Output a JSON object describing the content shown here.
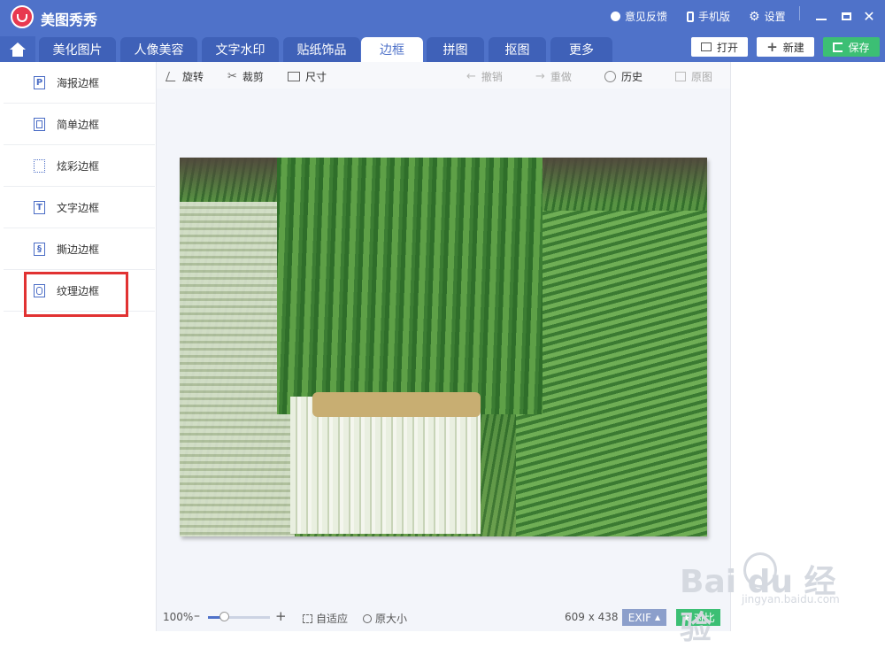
{
  "app": {
    "title": "美图秀秀"
  },
  "titlebar": {
    "feedback": "意见反馈",
    "mobile": "手机版",
    "settings": "设置",
    "icons": [
      "feedback-icon",
      "phone-icon",
      "gear-icon",
      "minimize-icon",
      "maximize-icon",
      "close-icon"
    ]
  },
  "tabs": [
    {
      "label": "美化图片",
      "active": false
    },
    {
      "label": "人像美容",
      "active": false
    },
    {
      "label": "文字水印",
      "active": false
    },
    {
      "label": "贴纸饰品",
      "active": false
    },
    {
      "label": "边框",
      "active": true
    },
    {
      "label": "拼图",
      "active": false
    },
    {
      "label": "抠图",
      "active": false
    },
    {
      "label": "更多",
      "active": false
    }
  ],
  "actions": {
    "open": "打开",
    "new": "新建",
    "save": "保存"
  },
  "sidebar": {
    "items": [
      {
        "label": "海报边框",
        "icon": "poster-frame-icon"
      },
      {
        "label": "简单边框",
        "icon": "simple-frame-icon"
      },
      {
        "label": "炫彩边框",
        "icon": "colorful-frame-icon"
      },
      {
        "label": "文字边框",
        "icon": "text-frame-icon"
      },
      {
        "label": "撕边边框",
        "icon": "torn-frame-icon"
      },
      {
        "label": "纹理边框",
        "icon": "texture-frame-icon",
        "highlighted": true
      }
    ]
  },
  "toolbar": {
    "rotate": "旋转",
    "crop": "裁剪",
    "size": "尺寸",
    "undo": "撤销",
    "redo": "重做",
    "history": "历史",
    "original": "原图"
  },
  "statusbar": {
    "zoom": "100%",
    "zoom_fraction": 0.25,
    "fit": "自适应",
    "actual_size": "原大小",
    "dimensions": "609 x 438",
    "exif": "EXIF",
    "compare": "对比"
  },
  "watermark": {
    "main": "Bai du 经验",
    "sub": "jingyan.baidu.com"
  },
  "colors": {
    "accent": "#4f72c9",
    "save_green": "#3cbf74",
    "highlight_red": "#e13232"
  }
}
